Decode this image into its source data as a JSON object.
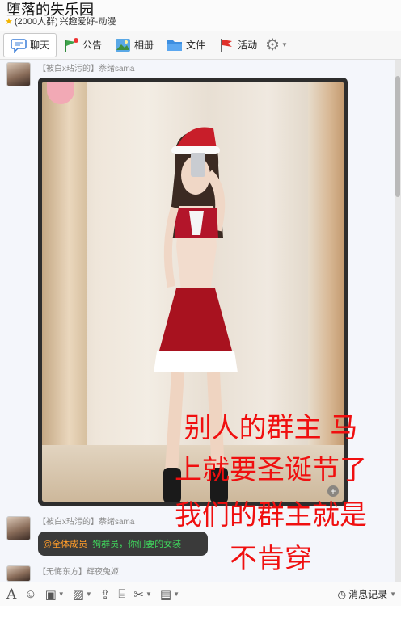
{
  "header": {
    "title": "堕落的失乐园",
    "member_count": "(2000人群)",
    "category": "兴趣爱好-动漫"
  },
  "tabs": [
    {
      "label": "聊天",
      "icon": "chat-icon",
      "active": true
    },
    {
      "label": "公告",
      "icon": "announcement-icon"
    },
    {
      "label": "相册",
      "icon": "album-icon"
    },
    {
      "label": "文件",
      "icon": "folder-icon"
    },
    {
      "label": "活动",
      "icon": "flag-icon"
    }
  ],
  "messages": [
    {
      "sender": "【被白x玷污的】萘绪sama",
      "type": "image"
    },
    {
      "sender": "【被白x玷污的】萘绪sama",
      "mention": "@全体成员",
      "text": "狗群员，你们要的女装"
    },
    {
      "sender": "【无悔东方】辉夜兔姬"
    }
  ],
  "overlay_text": {
    "line1": "别人的群主 马",
    "line2": "上就要圣诞节了",
    "line3": "我们的群主就是",
    "line4": "不肯穿"
  },
  "bottom_toolbar": {
    "history_label": "消息记录",
    "tools": [
      "font-icon",
      "emoji-icon",
      "gif-icon",
      "image-icon",
      "upload-icon",
      "gift-icon",
      "screenshot-icon",
      "more-icon"
    ]
  },
  "colors": {
    "overlay_text": "#f00f0f",
    "mention": "#ff9c2a",
    "message_text": "#3fd45c",
    "chat_bg": "#f4f6fb"
  }
}
